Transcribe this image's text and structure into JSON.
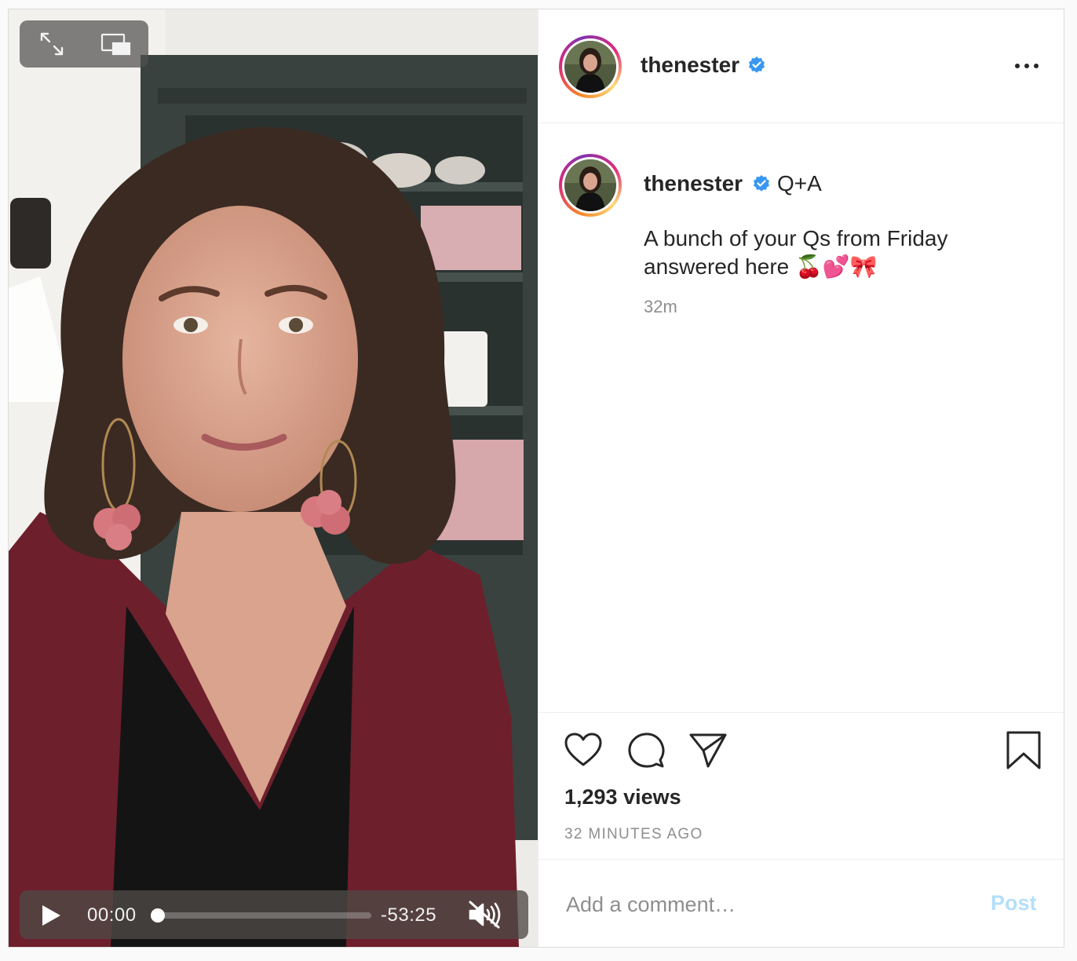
{
  "post": {
    "username": "thenester",
    "verified": true,
    "caption": {
      "title": "Q+A",
      "body": "A bunch of your Qs from Friday answered here 🍒💕🎀",
      "time": "32m"
    },
    "views": "1,293 views",
    "age": "32 MINUTES AGO"
  },
  "video": {
    "current_time": "00:00",
    "remaining_time": "-53:25",
    "progress": 0,
    "muted": true
  },
  "comment": {
    "placeholder": "Add a comment…",
    "post_label": "Post"
  },
  "icons": {
    "overlay": [
      "expand-icon",
      "picture-in-picture-icon"
    ],
    "controls": [
      "play-icon",
      "muted-speaker-icon"
    ],
    "header": [
      "more-options-icon"
    ],
    "actions": [
      "like-heart-icon",
      "comment-bubble-icon",
      "share-plane-icon",
      "save-bookmark-icon"
    ]
  },
  "colors": {
    "verified_badge": "#3897f0",
    "post_button_disabled": "#b2dffc",
    "secondary_text": "#8e8e8e",
    "primary_text": "#262626"
  }
}
